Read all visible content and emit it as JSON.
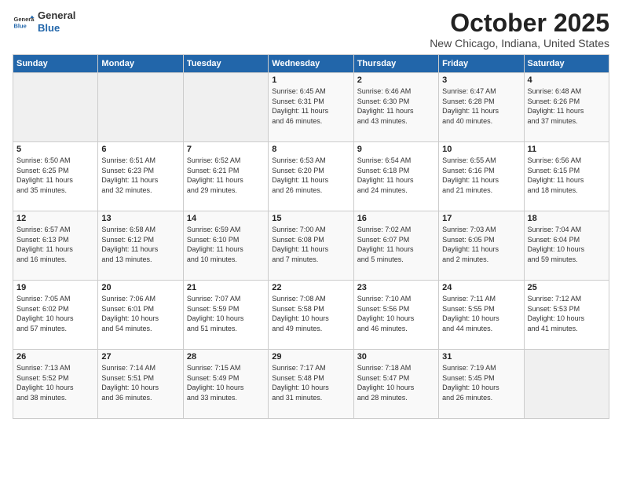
{
  "header": {
    "logo_line1": "General",
    "logo_line2": "Blue",
    "month": "October 2025",
    "location": "New Chicago, Indiana, United States"
  },
  "weekdays": [
    "Sunday",
    "Monday",
    "Tuesday",
    "Wednesday",
    "Thursday",
    "Friday",
    "Saturday"
  ],
  "weeks": [
    [
      {
        "day": "",
        "content": ""
      },
      {
        "day": "",
        "content": ""
      },
      {
        "day": "",
        "content": ""
      },
      {
        "day": "1",
        "content": "Sunrise: 6:45 AM\nSunset: 6:31 PM\nDaylight: 11 hours\nand 46 minutes."
      },
      {
        "day": "2",
        "content": "Sunrise: 6:46 AM\nSunset: 6:30 PM\nDaylight: 11 hours\nand 43 minutes."
      },
      {
        "day": "3",
        "content": "Sunrise: 6:47 AM\nSunset: 6:28 PM\nDaylight: 11 hours\nand 40 minutes."
      },
      {
        "day": "4",
        "content": "Sunrise: 6:48 AM\nSunset: 6:26 PM\nDaylight: 11 hours\nand 37 minutes."
      }
    ],
    [
      {
        "day": "5",
        "content": "Sunrise: 6:50 AM\nSunset: 6:25 PM\nDaylight: 11 hours\nand 35 minutes."
      },
      {
        "day": "6",
        "content": "Sunrise: 6:51 AM\nSunset: 6:23 PM\nDaylight: 11 hours\nand 32 minutes."
      },
      {
        "day": "7",
        "content": "Sunrise: 6:52 AM\nSunset: 6:21 PM\nDaylight: 11 hours\nand 29 minutes."
      },
      {
        "day": "8",
        "content": "Sunrise: 6:53 AM\nSunset: 6:20 PM\nDaylight: 11 hours\nand 26 minutes."
      },
      {
        "day": "9",
        "content": "Sunrise: 6:54 AM\nSunset: 6:18 PM\nDaylight: 11 hours\nand 24 minutes."
      },
      {
        "day": "10",
        "content": "Sunrise: 6:55 AM\nSunset: 6:16 PM\nDaylight: 11 hours\nand 21 minutes."
      },
      {
        "day": "11",
        "content": "Sunrise: 6:56 AM\nSunset: 6:15 PM\nDaylight: 11 hours\nand 18 minutes."
      }
    ],
    [
      {
        "day": "12",
        "content": "Sunrise: 6:57 AM\nSunset: 6:13 PM\nDaylight: 11 hours\nand 16 minutes."
      },
      {
        "day": "13",
        "content": "Sunrise: 6:58 AM\nSunset: 6:12 PM\nDaylight: 11 hours\nand 13 minutes."
      },
      {
        "day": "14",
        "content": "Sunrise: 6:59 AM\nSunset: 6:10 PM\nDaylight: 11 hours\nand 10 minutes."
      },
      {
        "day": "15",
        "content": "Sunrise: 7:00 AM\nSunset: 6:08 PM\nDaylight: 11 hours\nand 7 minutes."
      },
      {
        "day": "16",
        "content": "Sunrise: 7:02 AM\nSunset: 6:07 PM\nDaylight: 11 hours\nand 5 minutes."
      },
      {
        "day": "17",
        "content": "Sunrise: 7:03 AM\nSunset: 6:05 PM\nDaylight: 11 hours\nand 2 minutes."
      },
      {
        "day": "18",
        "content": "Sunrise: 7:04 AM\nSunset: 6:04 PM\nDaylight: 10 hours\nand 59 minutes."
      }
    ],
    [
      {
        "day": "19",
        "content": "Sunrise: 7:05 AM\nSunset: 6:02 PM\nDaylight: 10 hours\nand 57 minutes."
      },
      {
        "day": "20",
        "content": "Sunrise: 7:06 AM\nSunset: 6:01 PM\nDaylight: 10 hours\nand 54 minutes."
      },
      {
        "day": "21",
        "content": "Sunrise: 7:07 AM\nSunset: 5:59 PM\nDaylight: 10 hours\nand 51 minutes."
      },
      {
        "day": "22",
        "content": "Sunrise: 7:08 AM\nSunset: 5:58 PM\nDaylight: 10 hours\nand 49 minutes."
      },
      {
        "day": "23",
        "content": "Sunrise: 7:10 AM\nSunset: 5:56 PM\nDaylight: 10 hours\nand 46 minutes."
      },
      {
        "day": "24",
        "content": "Sunrise: 7:11 AM\nSunset: 5:55 PM\nDaylight: 10 hours\nand 44 minutes."
      },
      {
        "day": "25",
        "content": "Sunrise: 7:12 AM\nSunset: 5:53 PM\nDaylight: 10 hours\nand 41 minutes."
      }
    ],
    [
      {
        "day": "26",
        "content": "Sunrise: 7:13 AM\nSunset: 5:52 PM\nDaylight: 10 hours\nand 38 minutes."
      },
      {
        "day": "27",
        "content": "Sunrise: 7:14 AM\nSunset: 5:51 PM\nDaylight: 10 hours\nand 36 minutes."
      },
      {
        "day": "28",
        "content": "Sunrise: 7:15 AM\nSunset: 5:49 PM\nDaylight: 10 hours\nand 33 minutes."
      },
      {
        "day": "29",
        "content": "Sunrise: 7:17 AM\nSunset: 5:48 PM\nDaylight: 10 hours\nand 31 minutes."
      },
      {
        "day": "30",
        "content": "Sunrise: 7:18 AM\nSunset: 5:47 PM\nDaylight: 10 hours\nand 28 minutes."
      },
      {
        "day": "31",
        "content": "Sunrise: 7:19 AM\nSunset: 5:45 PM\nDaylight: 10 hours\nand 26 minutes."
      },
      {
        "day": "",
        "content": ""
      }
    ]
  ]
}
